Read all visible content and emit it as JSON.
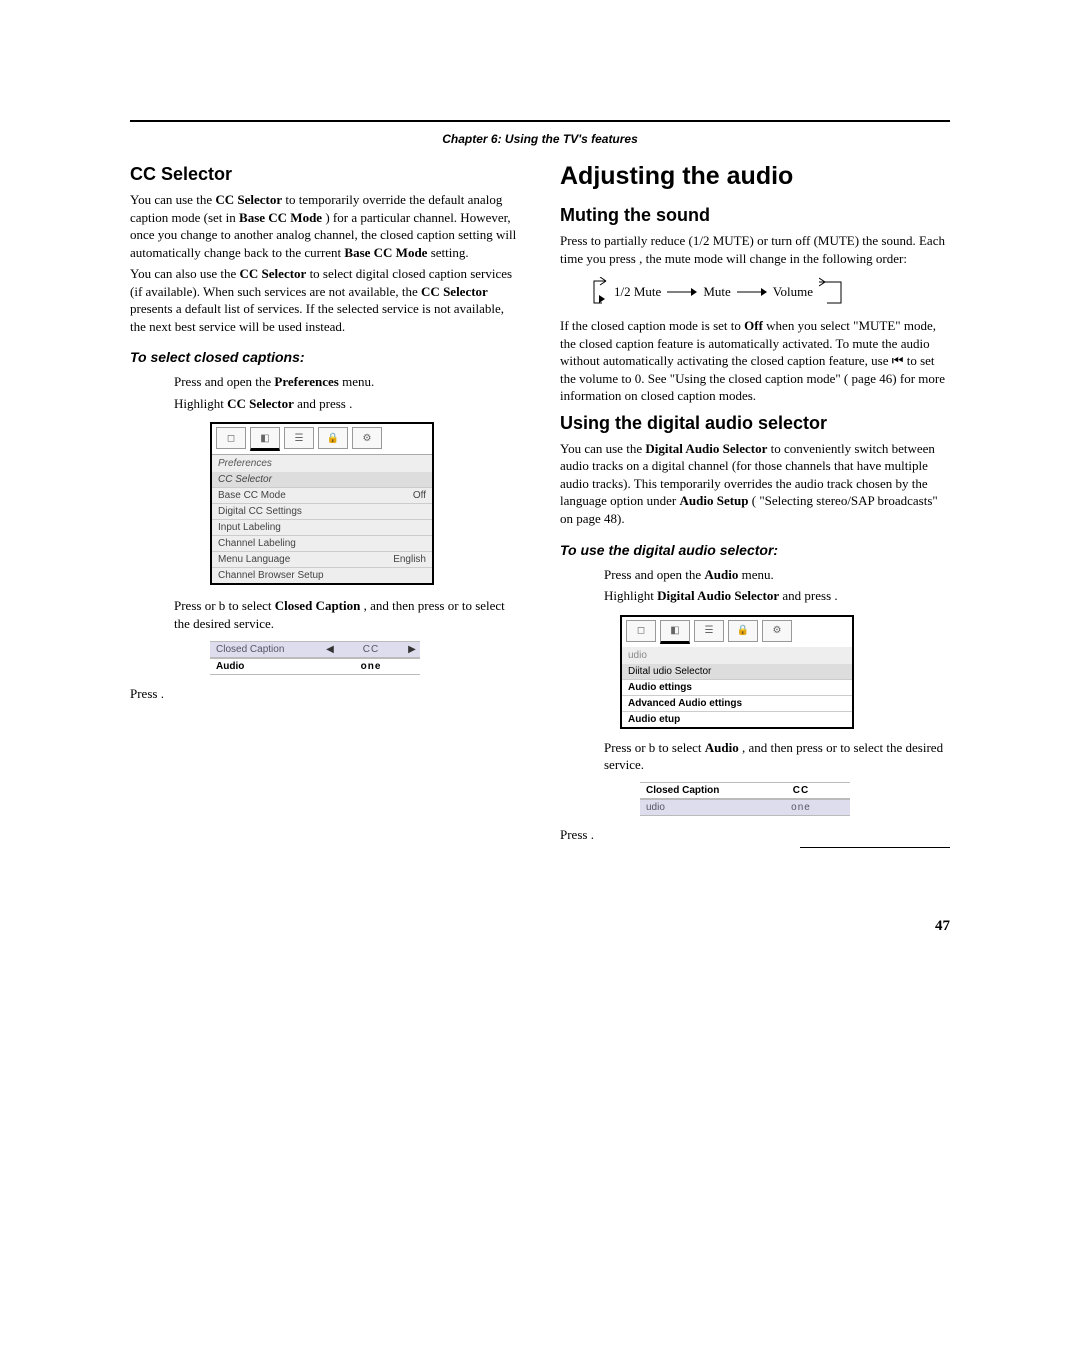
{
  "chapter_header": "Chapter 6: Using the TV's features",
  "left": {
    "h2": "CC Selector",
    "p1_a": "You can use the ",
    "p1_b": "CC Selector",
    "p1_c": " to temporarily override the default analog caption mode (set in ",
    "p1_d": "Base CC Mode",
    "p1_e": ") for a particular channel. However, once you change to another analog channel, the closed caption setting will automatically change back to the current ",
    "p1_f": "Base CC Mode",
    "p1_g": " setting.",
    "p2_a": "You can also use the ",
    "p2_b": "CC Selector",
    "p2_c": " to select digital closed caption services (if available). When such services are not available, the ",
    "p2_d": "CC Selector",
    "p2_e": " presents a default list of services. If the selected service is not available, the next best service will be used instead.",
    "sub": "To select closed captions:",
    "s1_a": "Press ",
    "s1_b": " and open the ",
    "s1_c": "Preferences",
    "s1_d": " menu.",
    "s2_a": "Highlight ",
    "s2_b": "CC Selector",
    "s2_c": " and press ",
    "s2_d": ".",
    "fig_pref": {
      "title": "Preferences",
      "sel": "CC Selector",
      "rows": [
        {
          "l": "Base CC Mode",
          "r": "Off"
        },
        {
          "l": "Digital CC Settings",
          "r": ""
        },
        {
          "l": "Input Labeling",
          "r": ""
        },
        {
          "l": "Channel Labeling",
          "r": ""
        },
        {
          "l": "Menu Language",
          "r": "English"
        },
        {
          "l": "Channel Browser Setup",
          "r": ""
        }
      ]
    },
    "s3_a": "Press ",
    "s3_b": " or b to select ",
    "s3_c": "Closed Caption",
    "s3_d": ", and then press ",
    "s3_e": " or ",
    "s3_f": " to select the desired service.",
    "fig_cc": {
      "r1_l": "Closed Caption",
      "r1_v": "CC",
      "r2_l": "Audio",
      "r2_v": "one"
    },
    "s4_a": "Press ",
    "s4_b": "."
  },
  "right": {
    "h1": "Adjusting the audio",
    "mute_h2": "Muting the sound",
    "mute_p1_a": "Press ",
    "mute_p1_b": " to partially reduce (1/2 MUTE) or turn off (MUTE) the sound. Each time you press ",
    "mute_p1_c": ", the mute mode will change in the following order:",
    "flow": {
      "a": "1/2 Mute",
      "b": "Mute",
      "c": "Volume"
    },
    "mute_p2_a": "If the closed caption mode is set to ",
    "mute_p2_b": "Off",
    "mute_p2_c": " when you select \"MUTE\" mode, the closed caption feature is automatically activated. To mute the audio without automatically activating the closed caption feature, use ",
    "mute_p2_d": " to set the volume to 0. See \"Using the closed caption mode\" (",
    "mute_p2_e": " page 46) for more information on closed caption modes.",
    "das_h2": "Using the digital audio selector",
    "das_p1_a": "You can use the ",
    "das_p1_b": "Digital Audio Selector",
    "das_p1_c": " to conveniently switch between audio tracks on a digital channel (for those channels that have multiple audio tracks). This temporarily overrides the audio track chosen by the language option under ",
    "das_p1_d": "Audio Setup",
    "das_p1_e": " (",
    "das_p1_f": " \"Selecting stereo/SAP broadcasts\" on page 48).",
    "das_sub": "To use the digital audio selector:",
    "das_s1_a": "Press ",
    "das_s1_b": " and open the ",
    "das_s1_c": "Audio",
    "das_s1_d": " menu.",
    "das_s2_a": "Highlight ",
    "das_s2_b": "Digital Audio Selector",
    "das_s2_c": " and press ",
    "das_s2_d": ".",
    "fig_audio": {
      "title": "udio",
      "sel": "Diital udio Selector",
      "rows": [
        "Audio ettings",
        "Advanced Audio ettings",
        "Audio etup"
      ]
    },
    "das_s3_a": "Press ",
    "das_s3_b": " or b to select ",
    "das_s3_c": "Audio",
    "das_s3_d": ", and then press ",
    "das_s3_e": " or ",
    "das_s3_f": " to select the desired service.",
    "fig_cc2": {
      "r1_l": "Closed Caption",
      "r1_v": "CC",
      "r2_l": "udio",
      "r2_v": "one"
    },
    "das_s4_a": "Press ",
    "das_s4_b": "."
  },
  "page_number": "47"
}
